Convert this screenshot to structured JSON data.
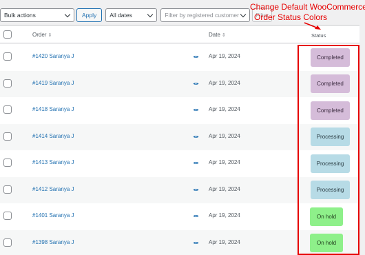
{
  "filters": {
    "bulk_actions": "Bulk actions",
    "apply": "Apply",
    "all_dates": "All dates",
    "customer_placeholder": "Filter by registered customer",
    "filter": "Filter"
  },
  "annotation": {
    "line1": "Change  Default  WooCommerce",
    "line2": "Order Status Colors",
    "color": "#e60000"
  },
  "table": {
    "columns": {
      "order": "Order",
      "date": "Date",
      "status": "Status"
    },
    "sort_glyph": "⇕",
    "rows": [
      {
        "order": "#1420 Saranya J",
        "date": "Apr 19, 2024",
        "status": "Completed"
      },
      {
        "order": "#1419 Saranya J",
        "date": "Apr 19, 2024",
        "status": "Completed"
      },
      {
        "order": "#1418 Saranya J",
        "date": "Apr 19, 2024",
        "status": "Completed"
      },
      {
        "order": "#1414 Saranya J",
        "date": "Apr 19, 2024",
        "status": "Processing"
      },
      {
        "order": "#1413 Saranya J",
        "date": "Apr 19, 2024",
        "status": "Processing"
      },
      {
        "order": "#1412 Saranya J",
        "date": "Apr 19, 2024",
        "status": "Processing"
      },
      {
        "order": "#1401 Saranya J",
        "date": "Apr 19, 2024",
        "status": "On hold"
      },
      {
        "order": "#1398 Saranya J",
        "date": "Apr 19, 2024",
        "status": "On hold"
      }
    ]
  },
  "status_colors": {
    "Completed": {
      "bg": "#d5bcd9",
      "fg": "#3c2b40"
    },
    "Processing": {
      "bg": "#b7dbe6",
      "fg": "#2b3d44"
    },
    "On hold": {
      "bg": "#8ef08a",
      "fg": "#1f3b1c"
    }
  },
  "icons": {
    "row_action": "eye-icon",
    "header_checkbox": "checkbox"
  }
}
